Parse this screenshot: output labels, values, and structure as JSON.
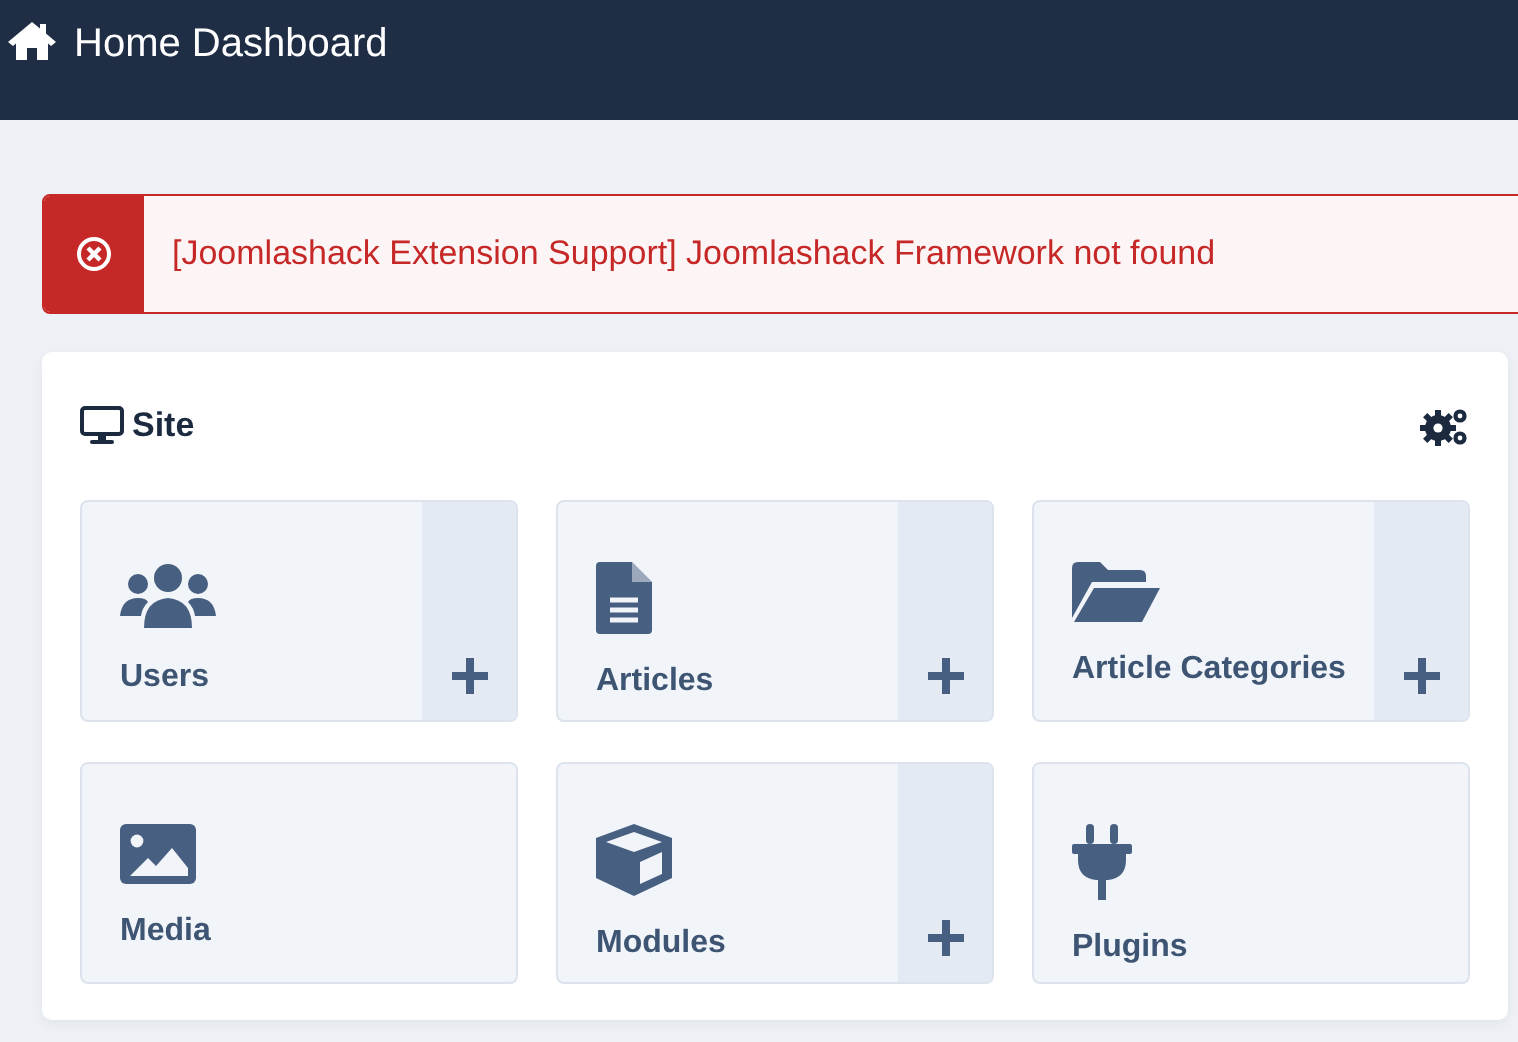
{
  "header": {
    "title": "Home Dashboard"
  },
  "alert": {
    "message": "[Joomlashack Extension Support] Joomlashack Framework not found"
  },
  "site_card": {
    "title": "Site",
    "tiles": [
      {
        "label": "Users",
        "add": true
      },
      {
        "label": "Articles",
        "add": true
      },
      {
        "label": "Article Categories",
        "add": true
      },
      {
        "label": "Media",
        "add": false
      },
      {
        "label": "Modules",
        "add": true
      },
      {
        "label": "Plugins",
        "add": false
      }
    ]
  }
}
